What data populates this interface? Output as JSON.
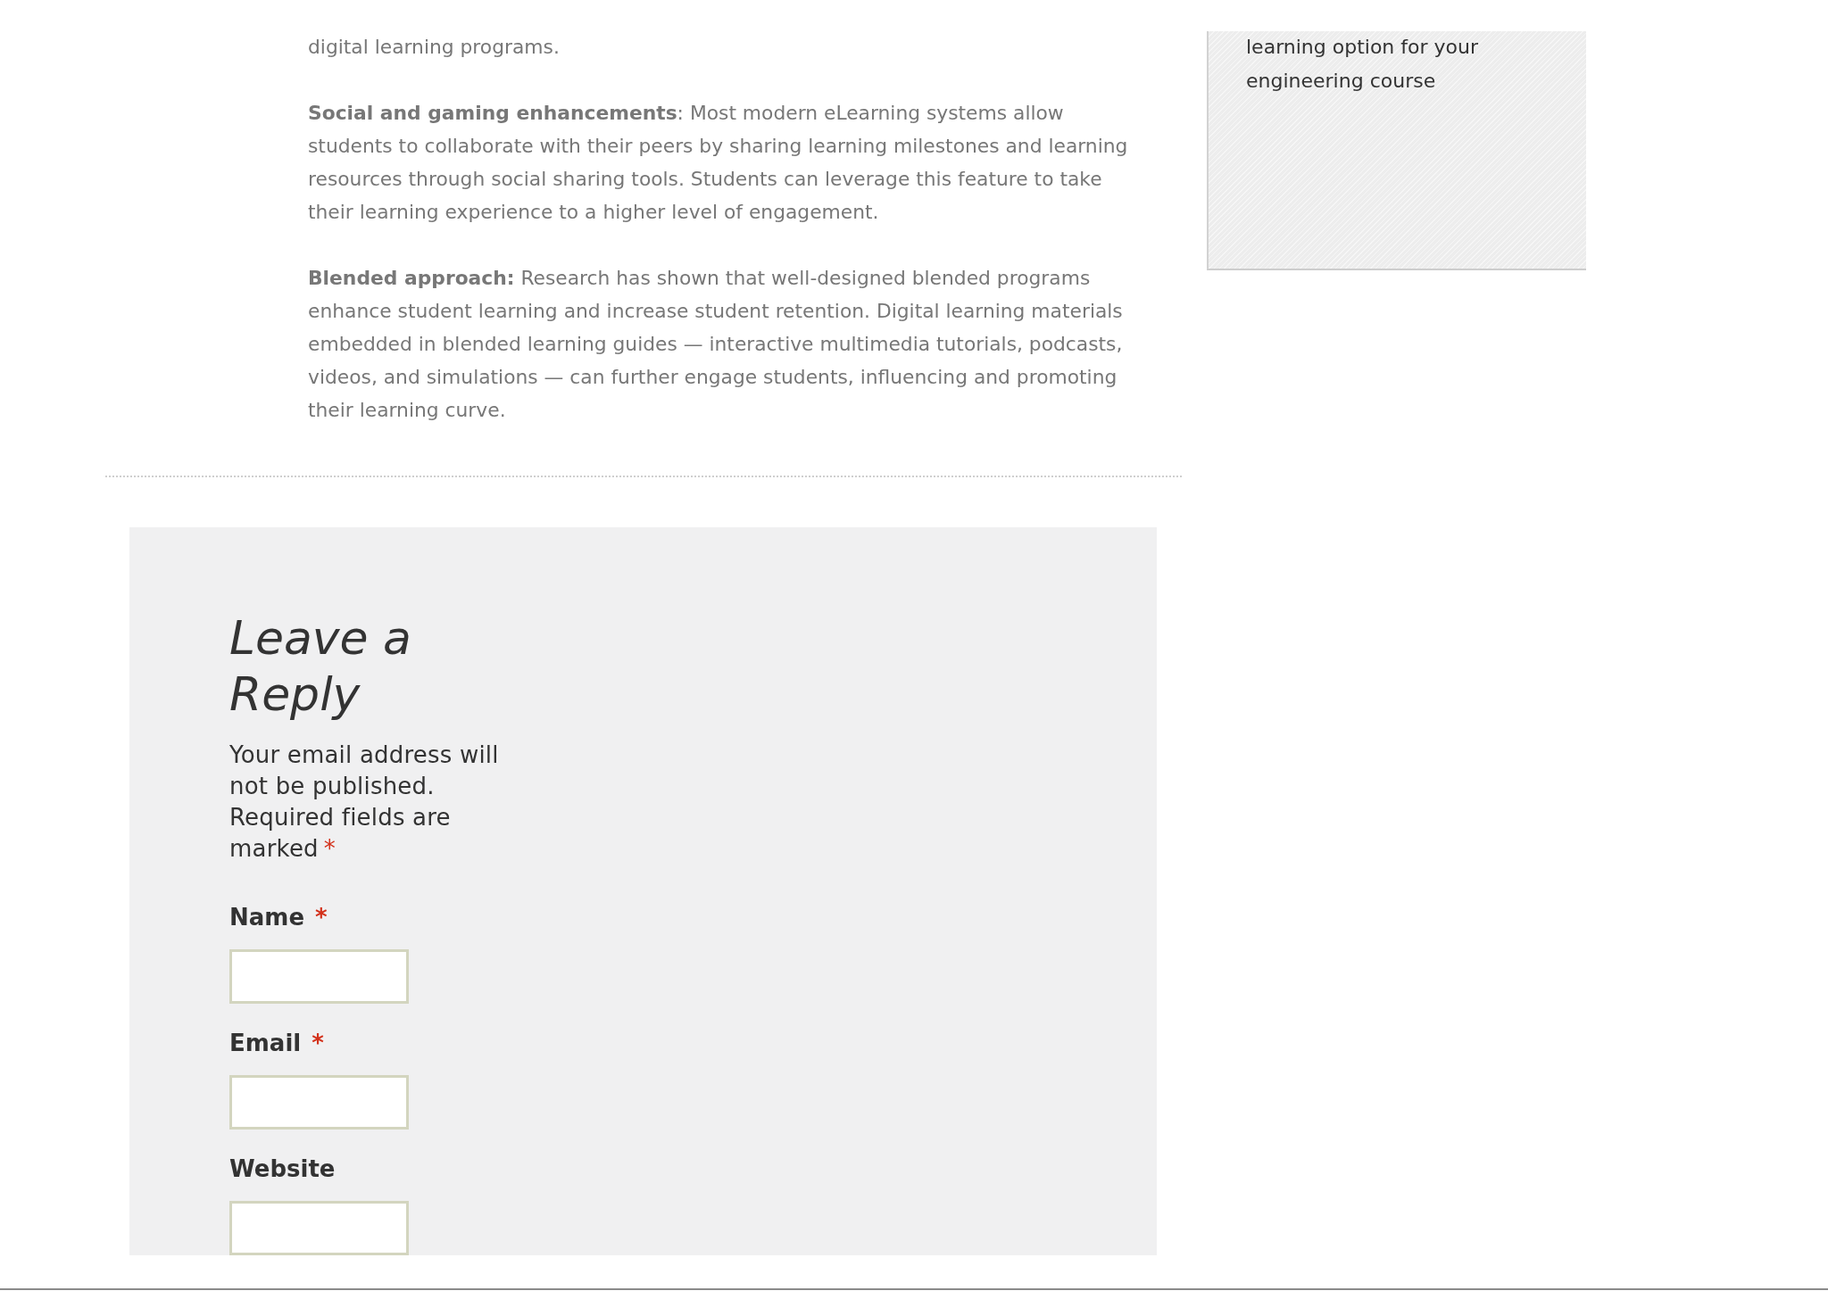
{
  "article": {
    "paragraphs": [
      "digital learning programs.",
      "**Social and gaming enhancements**: Most modern eLearning systems allow students to collaborate with their peers by sharing learning milestones and learning resources through social sharing tools. Students can leverage this feature to take their learning experience to a higher level of engagement.",
      "**Blended approach:** Research has shown that well-designed blended programs enhance student learning and increase student retention. Digital learning materials embedded in blended learning guides — interactive multimedia tutorials, podcasts, videos, and simulations — can further engage students, influencing and promoting their learning curve."
    ]
  },
  "sidebar": {
    "text": "learning option for your engineering course"
  },
  "reply_form": {
    "title": "Leave a Reply",
    "notice": "Your email address will not be published. Required fields are marked",
    "notice_mark": "*",
    "fields": [
      {
        "label": "Name",
        "required_mark": "*"
      },
      {
        "label": "Email",
        "required_mark": "*"
      },
      {
        "label": "Website"
      }
    ]
  }
}
